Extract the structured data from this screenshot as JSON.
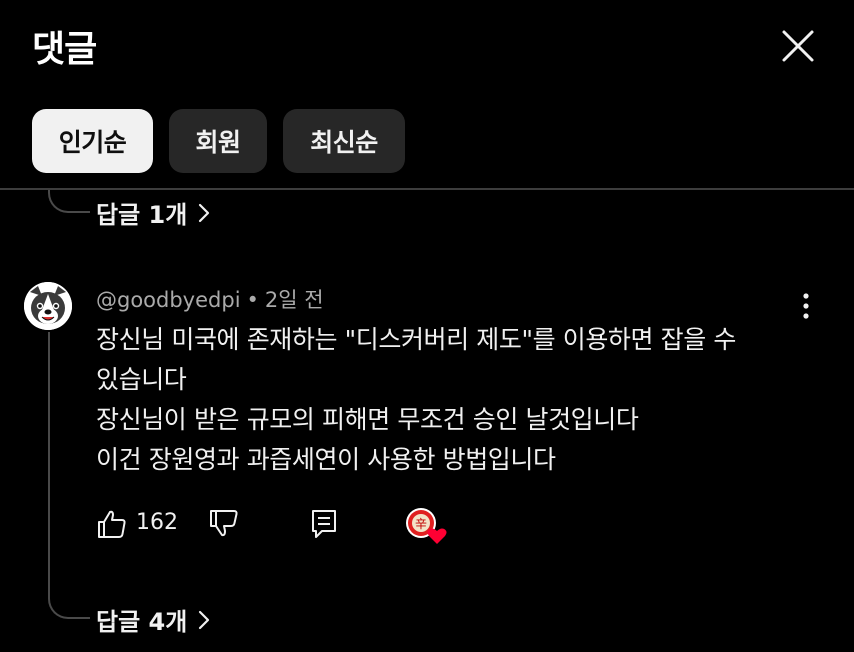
{
  "header": {
    "title": "댓글"
  },
  "filters": {
    "items": [
      {
        "label": "인기순",
        "active": true
      },
      {
        "label": "회원",
        "active": false
      },
      {
        "label": "최신순",
        "active": false
      }
    ]
  },
  "previous_thread": {
    "replies_label": "답글 1개"
  },
  "comment": {
    "author": "@goodbyedpi",
    "separator": "•",
    "time": "2일 전",
    "lines": [
      "장신님 미국에 존재하는 \"디스커버리 제도\"를 이용하면 잡을 수",
      "있습니다",
      "장신님이 받은 규모의 피해면 무조건 승인 날것입니다",
      "이건 장원영과 과즙세연이 사용한 방법입니다"
    ],
    "like_count": "162",
    "replies_label": "답글 4개",
    "creator_heart_char": "辛"
  },
  "colors": {
    "background": "#000000",
    "chip_bg": "#272727",
    "chip_active_bg": "#f1f1f1",
    "meta_text": "#aaaaaa",
    "heart": "#ff0033"
  },
  "icons": {
    "close": "close-icon",
    "chevron": "chevron-right-icon",
    "like": "thumb-up-icon",
    "dislike": "thumb-down-icon",
    "reply": "comment-reply-icon",
    "more": "more-vert-icon",
    "heart": "creator-heart-icon"
  }
}
